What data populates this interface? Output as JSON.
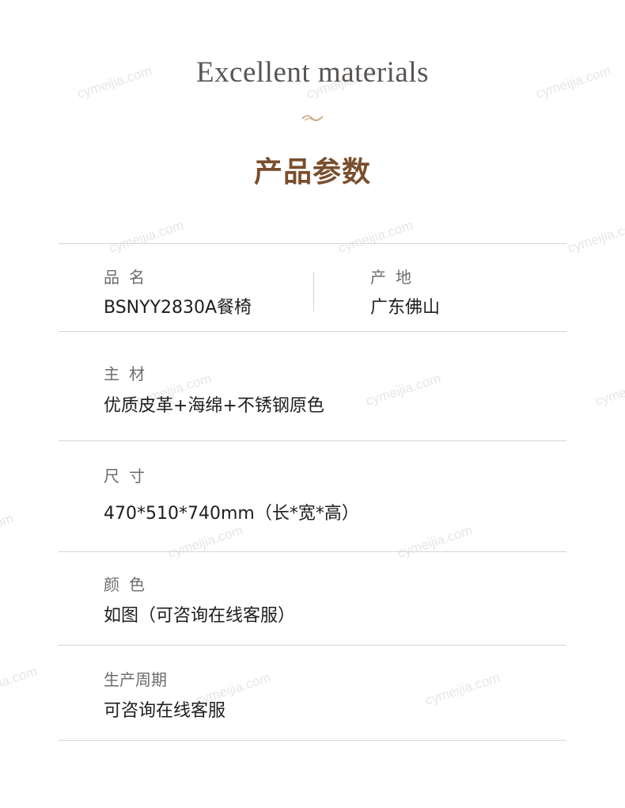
{
  "header": {
    "title_en": "Excellent materials",
    "title_cn": "产品参数"
  },
  "params": {
    "name": {
      "label": "品名",
      "value": "BSNYY2830A餐椅"
    },
    "origin": {
      "label": "产地",
      "value": "广东佛山"
    },
    "material": {
      "label": "主材",
      "value": "优质皮革+海绵+不锈钢原色"
    },
    "size": {
      "label": "尺寸",
      "value": "470*510*740mm（长*宽*高）"
    },
    "color": {
      "label": "颜色",
      "value": "如图（可咨询在线客服）"
    },
    "cycle": {
      "label": "生产周期",
      "value": "可咨询在线客服"
    }
  },
  "watermark": "cymeijia.com",
  "colors": {
    "accent": "#7a4e2d",
    "ornament": "#c9a27a",
    "divider": "#d6d6d6"
  }
}
